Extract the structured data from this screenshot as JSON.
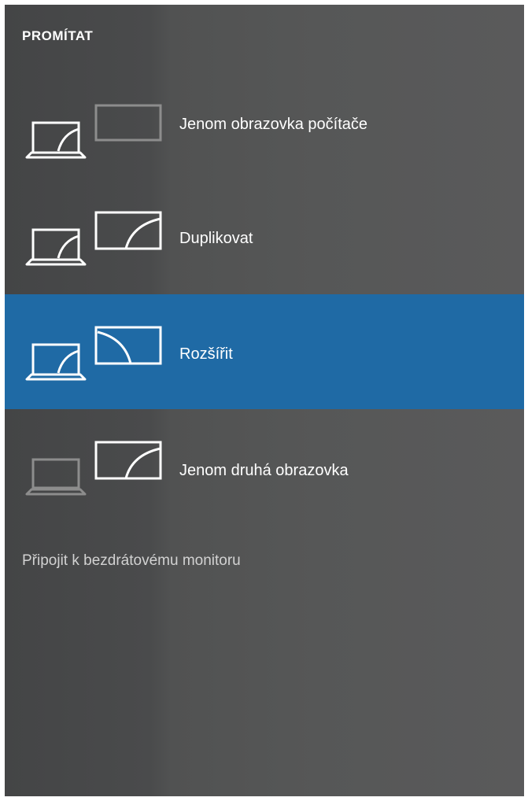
{
  "panel": {
    "title": "PROMÍTAT"
  },
  "options": [
    {
      "label": "Jenom obrazovka počítače",
      "icon": "pc-screen-only-icon",
      "selected": false
    },
    {
      "label": "Duplikovat",
      "icon": "duplicate-icon",
      "selected": false
    },
    {
      "label": "Rozšířit",
      "icon": "extend-icon",
      "selected": true
    },
    {
      "label": "Jenom druhá obrazovka",
      "icon": "second-screen-only-icon",
      "selected": false
    }
  ],
  "wireless": {
    "label": "Připojit k bezdrátovému monitoru"
  },
  "colors": {
    "panel_background": "#4b4c4d",
    "selection": "#1f6aa5",
    "text": "#ffffff",
    "link_text": "#d2d2d2"
  }
}
